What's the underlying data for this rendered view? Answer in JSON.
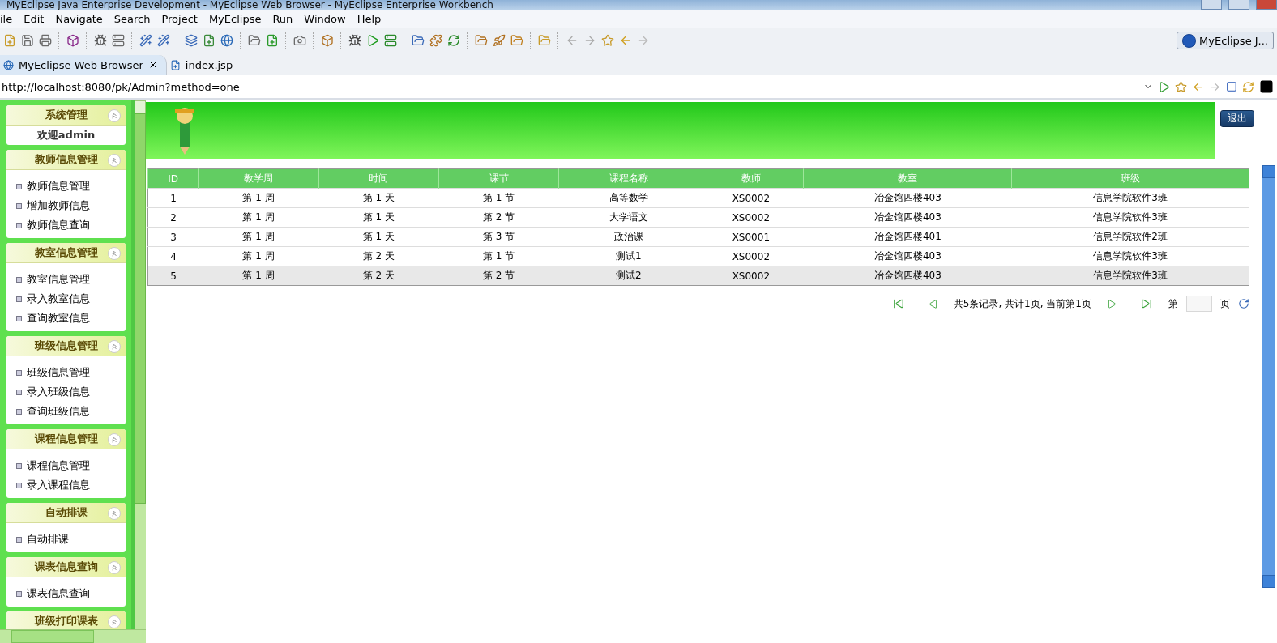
{
  "window": {
    "title": "MyEclipse Java Enterprise Development - MyEclipse Web Browser - MyEclipse Enterprise Workbench"
  },
  "menu": [
    "ile",
    "Edit",
    "Navigate",
    "Search",
    "Project",
    "MyEclipse",
    "Run",
    "Window",
    "Help"
  ],
  "perspective": "MyEclipse J...",
  "editor_tabs": [
    {
      "label": "MyEclipse Web Browser",
      "selected": true,
      "closable": true
    },
    {
      "label": "index.jsp",
      "selected": false,
      "closable": false
    }
  ],
  "address": "http://localhost:8080/pk/Admin?method=one",
  "sidebar": [
    {
      "kind": "welcome",
      "title": "系统管理",
      "text": "欢迎admin"
    },
    {
      "kind": "links",
      "title": "教师信息管理",
      "items": [
        "教师信息管理",
        "增加教师信息",
        "教师信息查询"
      ]
    },
    {
      "kind": "links",
      "title": "教室信息管理",
      "items": [
        "教室信息管理",
        "录入教室信息",
        "查询教室信息"
      ]
    },
    {
      "kind": "links",
      "title": "班级信息管理",
      "items": [
        "班级信息管理",
        "录入班级信息",
        "查询班级信息"
      ]
    },
    {
      "kind": "links",
      "title": "课程信息管理",
      "items": [
        "课程信息管理",
        "录入课程信息"
      ]
    },
    {
      "kind": "links",
      "title": "自动排课",
      "items": [
        "自动排课"
      ]
    },
    {
      "kind": "links",
      "title": "课表信息查询",
      "items": [
        "课表信息查询"
      ]
    },
    {
      "kind": "links",
      "title": "班级打印课表"
    }
  ],
  "logout": "退出",
  "table": {
    "columns": [
      "ID",
      "教学周",
      "时间",
      "课节",
      "课程名称",
      "教师",
      "教室",
      "班级"
    ],
    "rows": [
      {
        "selected": false,
        "cells": [
          "1",
          "第 1 周",
          "第 1 天",
          "第 1 节",
          "高等数学",
          "XS0002",
          "冶金馆四楼403",
          "信息学院软件3班"
        ]
      },
      {
        "selected": false,
        "cells": [
          "2",
          "第 1 周",
          "第 1 天",
          "第 2 节",
          "大学语文",
          "XS0002",
          "冶金馆四楼403",
          "信息学院软件3班"
        ]
      },
      {
        "selected": false,
        "cells": [
          "3",
          "第 1 周",
          "第 1 天",
          "第 3 节",
          "政治课",
          "XS0001",
          "冶金馆四楼401",
          "信息学院软件2班"
        ]
      },
      {
        "selected": false,
        "cells": [
          "4",
          "第 1 周",
          "第 2 天",
          "第 1 节",
          "测试1",
          "XS0002",
          "冶金馆四楼403",
          "信息学院软件3班"
        ]
      },
      {
        "selected": true,
        "cells": [
          "5",
          "第 1 周",
          "第 2 天",
          "第 2 节",
          "测试2",
          "XS0002",
          "冶金馆四楼403",
          "信息学院软件3班"
        ]
      }
    ]
  },
  "pagination": {
    "summary": "共5条记录, 共计1页, 当前第1页",
    "page_prefix": "第",
    "page_suffix": "页"
  }
}
